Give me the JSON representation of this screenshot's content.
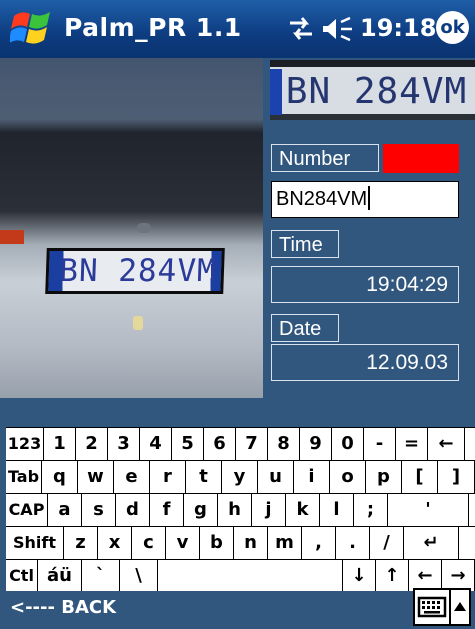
{
  "titlebar": {
    "app_title": "Palm_PR 1.1",
    "clock": "19:18",
    "ok_label": "ok",
    "icons": [
      "windows-logo-icon",
      "connectivity-icon",
      "speaker-icon"
    ]
  },
  "photo": {
    "plate_text": "BN 284VM",
    "crop_plate_text": "BN 284VM"
  },
  "fields": {
    "number_label": "Number",
    "number_value": "BN284VM",
    "number_status_color": "#ff0000",
    "time_label": "Time",
    "time_value": "19:04:29",
    "date_label": "Date",
    "date_value": "12.09.03"
  },
  "keyboard": {
    "rows": [
      [
        "123",
        "1",
        "2",
        "3",
        "4",
        "5",
        "6",
        "7",
        "8",
        "9",
        "0",
        "-",
        "=",
        "←"
      ],
      [
        "Tab",
        "q",
        "w",
        "e",
        "r",
        "t",
        "y",
        "u",
        "i",
        "o",
        "p",
        "[",
        "]"
      ],
      [
        "CAP",
        "a",
        "s",
        "d",
        "f",
        "g",
        "h",
        "j",
        "k",
        "l",
        ";",
        "'"
      ],
      [
        "Shift",
        "z",
        "x",
        "c",
        "v",
        "b",
        "n",
        "m",
        ",",
        ".",
        "/",
        "↵"
      ],
      [
        "Ctl",
        "áü",
        "`",
        "\\",
        " ",
        "↓",
        "↑",
        "←",
        "→"
      ]
    ]
  },
  "bottombar": {
    "back_label": "<---- BACK",
    "icons": [
      "keyboard-icon",
      "up-arrow-icon"
    ]
  },
  "colors": {
    "background": "#32577f",
    "titlebar": "#0d3c80",
    "status_red": "#ff0000"
  }
}
